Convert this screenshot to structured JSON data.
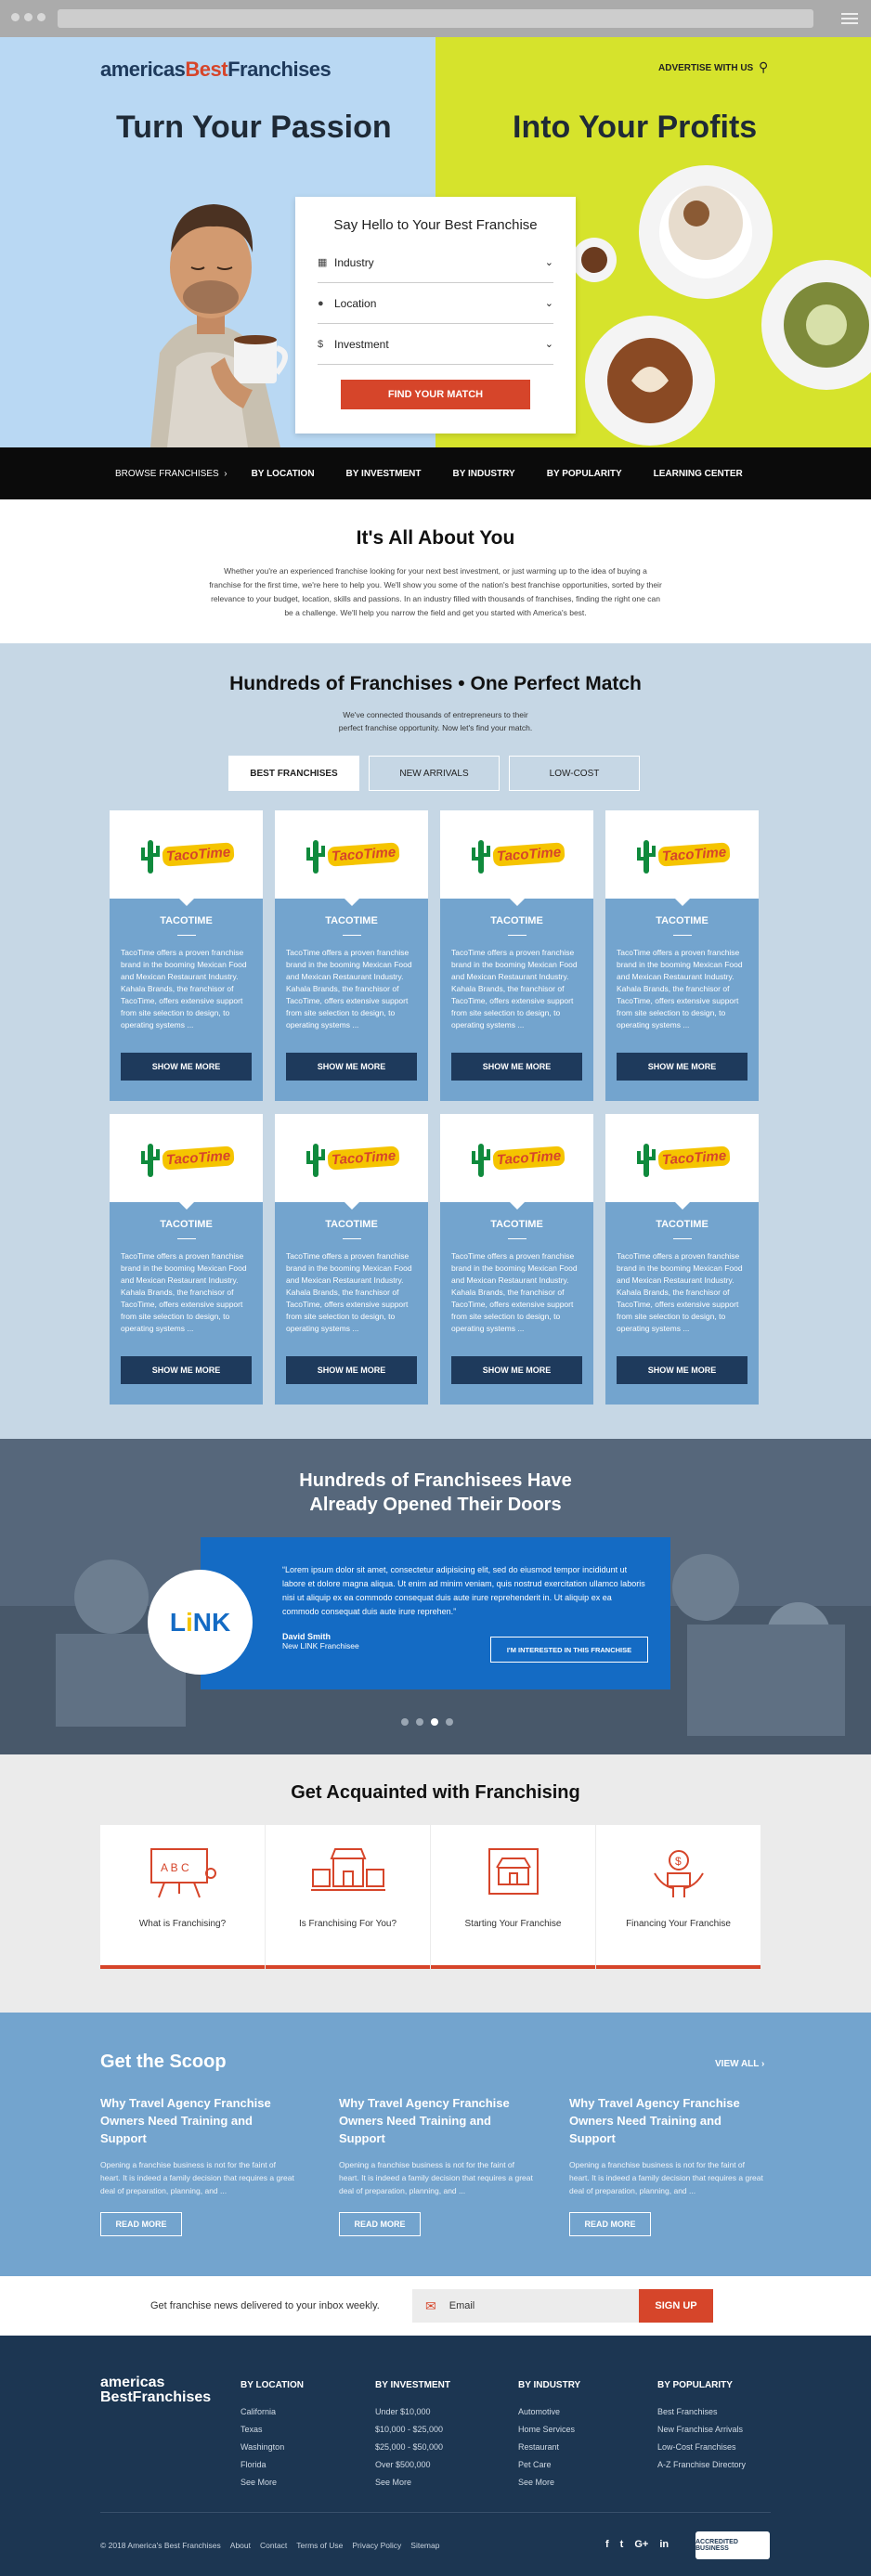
{
  "header": {
    "logo_a": "americas",
    "logo_b": "Best",
    "logo_c": "Franchises",
    "advertise": "ADVERTISE WITH US",
    "headline_left": "Turn Your Passion",
    "headline_right": "Into Your Profits"
  },
  "form": {
    "title": "Say Hello to Your Best Franchise",
    "industry": "Industry",
    "location": "Location",
    "investment": "Investment",
    "button": "FIND YOUR MATCH"
  },
  "nav": [
    "BROWSE FRANCHISES",
    "BY LOCATION",
    "BY INVESTMENT",
    "BY INDUSTRY",
    "BY POPULARITY",
    "LEARNING CENTER"
  ],
  "about": {
    "title": "It's All About You",
    "text": "Whether you're an experienced franchise looking for your next best investment, or just warming up to the idea of buying a franchise for the first time, we're here to help you. We'll show you some of the nation's best franchise opportunities, sorted by their relevance to your budget, location, skills and passions. In an industry filled with thousands of franchises, finding the right one can be a challenge. We'll help you narrow the field and get you started with America's best."
  },
  "franchises": {
    "title": "Hundreds of Franchises • One Perfect Match",
    "subtitle": "We've connected thousands of entrepreneurs to their perfect franchise opportunity. Now let's find your match.",
    "tabs": [
      "BEST FRANCHISES",
      "NEW ARRIVALS",
      "LOW-COST"
    ],
    "card_logo": "TacoTime",
    "card_name": "TACOTIME",
    "card_desc": "TacoTime offers a proven franchise brand in the booming Mexican Food and Mexican Restaurant Industry. Kahala Brands, the franchisor of TacoTime, offers extensive support from site selection to design, to operating systems ...",
    "card_button": "SHOW ME MORE"
  },
  "testimonial": {
    "title_1": "Hundreds of Franchisees Have",
    "title_2": "Already Opened Their Doors",
    "quote": "“Lorem ipsum dolor sit amet, consectetur adipisicing elit, sed do eiusmod tempor incididunt ut labore et dolore magna aliqua. Ut enim ad minim veniam, quis nostrud exercitation ullamco laboris nisi ut aliquip ex ea commodo consequat duis aute irure reprehenderit in. Ut aliquip ex ea commodo consequat duis aute irure reprehen.”",
    "author": "David Smith",
    "position": "New LINK Franchisee",
    "logo_a": "L",
    "logo_b": "i",
    "logo_c": "NK",
    "button": "I'M INTERESTED IN THIS FRANCHISE"
  },
  "acquainted": {
    "title": "Get Acquainted with Franchising",
    "items": [
      "What is Franchising?",
      "Is Franchising For You?",
      "Starting Your Franchise",
      "Financing Your Franchise"
    ],
    "board_text": "A B C"
  },
  "scoop": {
    "title": "Get the Scoop",
    "view_all": "VIEW ALL ›",
    "articles": [
      {
        "title": "Why Travel Agency Franchise Owners Need Training and Support",
        "text": "Opening a franchise business is not for the faint of heart. It is indeed a family decision that requires a great deal of preparation, planning, and ...",
        "button": "READ MORE"
      },
      {
        "title": "Why Travel Agency Franchise Owners Need Training and Support",
        "text": "Opening a franchise business is not for the faint of heart. It is indeed a family decision that requires a great deal of preparation, planning, and ...",
        "button": "READ MORE"
      },
      {
        "title": "Why Travel Agency Franchise Owners Need Training and Support",
        "text": "Opening a franchise business is not for the faint of heart. It is indeed a family decision that requires a great deal of preparation, planning, and ...",
        "button": "READ MORE"
      }
    ]
  },
  "newsletter": {
    "text": "Get franchise news delivered to your inbox weekly.",
    "placeholder": "Email",
    "button": "SIGN UP"
  },
  "footer": {
    "logo_a": "americas",
    "logo_b": "BestFranchises",
    "columns": [
      {
        "head": "BY LOCATION",
        "links": [
          "California",
          "Texas",
          "Washington",
          "Florida",
          "See More"
        ]
      },
      {
        "head": "BY INVESTMENT",
        "links": [
          "Under $10,000",
          "$10,000 - $25,000",
          "$25,000 - $50,000",
          "Over $500,000",
          "See More"
        ]
      },
      {
        "head": "BY INDUSTRY",
        "links": [
          "Automotive",
          "Home Services",
          "Restaurant",
          "Pet Care",
          "See More"
        ]
      },
      {
        "head": "BY POPULARITY",
        "links": [
          "Best Franchises",
          "New Franchise Arrivals",
          "Low-Cost Franchises",
          "A-Z Franchise Directory"
        ]
      }
    ],
    "copyright": "© 2018 America's Best Franchises",
    "links": [
      "About",
      "Contact",
      "Terms of Use",
      "Privacy Policy",
      "Sitemap"
    ],
    "social": [
      "f",
      "t",
      "G+",
      "in"
    ],
    "bbb": "ACCREDITED BUSINESS"
  },
  "colors": {
    "accent": "#d6452a",
    "navy": "#1e3a5c",
    "card_blue": "#73a4ce",
    "testimonial_blue": "#146bc4",
    "hero_left": "#b9d8f3",
    "hero_right": "#d6e32c"
  }
}
